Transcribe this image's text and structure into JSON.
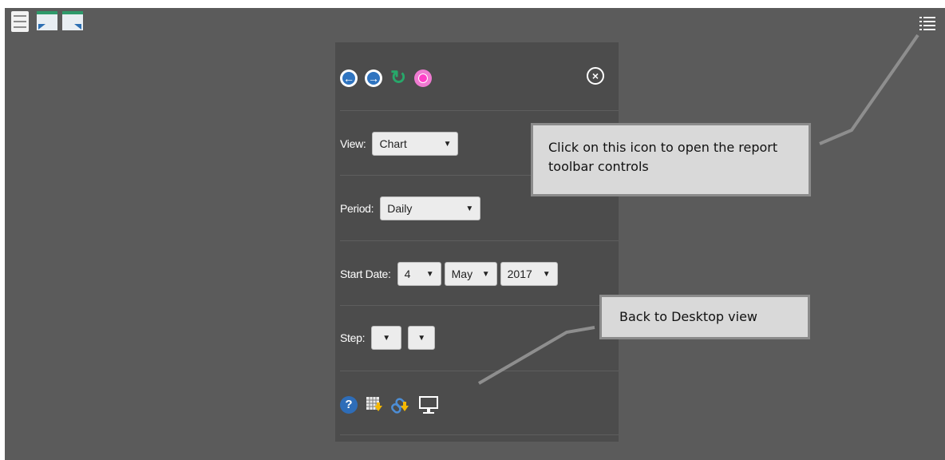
{
  "toolbar_top_left": {
    "icons": [
      "file-cabinet-icon",
      "window-arrow-back-icon",
      "window-arrow-forward-icon"
    ]
  },
  "toolbar_top_right": {
    "icon": "list-menu-icon"
  },
  "panel": {
    "nav_icons": [
      "back-arrow-icon",
      "forward-arrow-icon",
      "refresh-icon",
      "record-icon"
    ],
    "close_icon": "close-circle-icon",
    "view": {
      "label": "View:",
      "value": "Chart"
    },
    "period": {
      "label": "Period:",
      "value": "Daily"
    },
    "start_date": {
      "label": "Start Date:",
      "day": "4",
      "month": "May",
      "year": "2017"
    },
    "step": {
      "label": "Step:",
      "first": "",
      "second": ""
    },
    "bottom_icons": [
      "help-icon",
      "export-grid-icon",
      "link-download-icon",
      "desktop-monitor-icon"
    ]
  },
  "callouts": {
    "toolbar": "Click on this icon to open the report toolbar controls",
    "desktop": "Back to Desktop view"
  },
  "colors": {
    "background": "#5b5b5b",
    "panel": "#4c4c4c",
    "callout": "#d9d9d9",
    "accent_blue": "#2f74c0",
    "accent_green": "#27a86a",
    "accent_pink": "#ff3ec7"
  }
}
